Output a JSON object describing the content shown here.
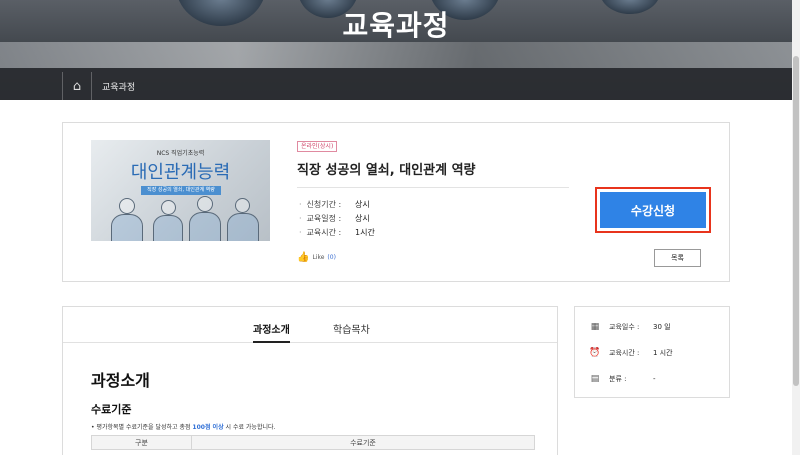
{
  "hero": {
    "title": "교육과정"
  },
  "breadcrumb": {
    "home_icon": "home-icon",
    "current": "교육과정"
  },
  "course": {
    "thumbnail": {
      "top_text": "NCS 직업기초능력",
      "main_text": "대인관계능력",
      "sub_text": "직장 성공의 열쇠, 대인관계 역량"
    },
    "badge": "온라인(상시)",
    "title": "직장 성공의 열쇠, 대인관계 역량",
    "info": [
      {
        "label": "신청기간 :",
        "value": "상시"
      },
      {
        "label": "교육일정 :",
        "value": "상시"
      },
      {
        "label": "교육시간 :",
        "value": "1시간"
      }
    ],
    "like_label": "Like",
    "like_count": "(0)",
    "enroll_label": "수강신청",
    "list_label": "목록"
  },
  "tabs": [
    {
      "label": "과정소개",
      "active": true
    },
    {
      "label": "학습목차",
      "active": false
    }
  ],
  "content": {
    "section_title": "과정소개",
    "subsection_title": "수료기준",
    "note_prefix": "• 평가항목별 수료기준을 달성하고 총점",
    "note_highlight": "100점 이상",
    "note_suffix": "시 수료 가능합니다.",
    "table_header": "수료기준",
    "table_col1": "구분"
  },
  "side": [
    {
      "icon": "calendar-icon",
      "label": "교육일수 :",
      "value": "30 일"
    },
    {
      "icon": "alarm-clock-icon",
      "label": "교육시간 :",
      "value": "1 시간"
    },
    {
      "icon": "document-icon",
      "label": "분류 :",
      "value": "-"
    }
  ],
  "colors": {
    "accent": "#2f83e6",
    "highlight_border": "#e8341c",
    "badge": "#d0456a"
  }
}
